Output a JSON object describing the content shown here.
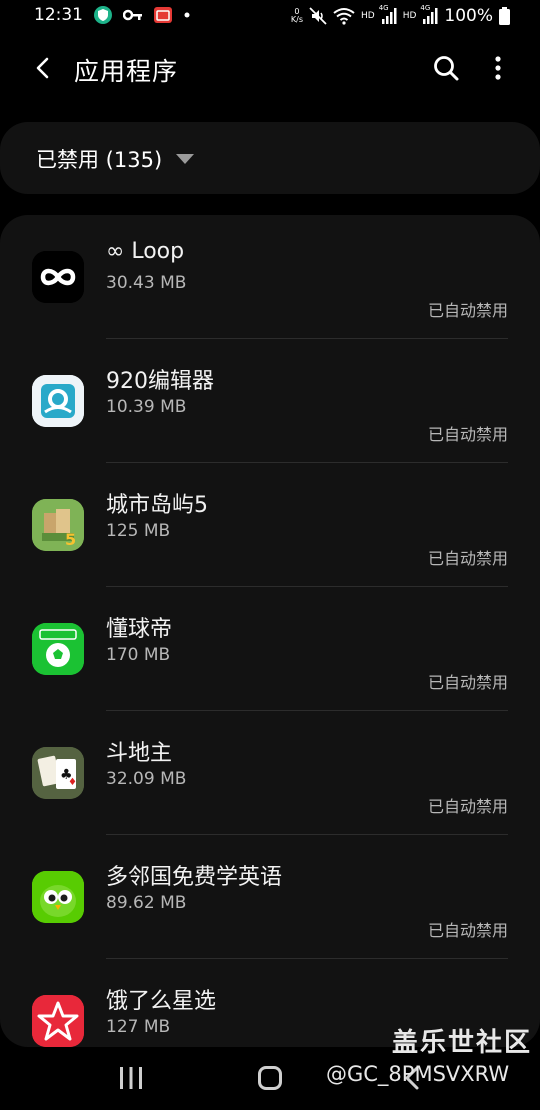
{
  "status_bar": {
    "time": "12:31",
    "speed_top": "0",
    "speed_bottom": "K/s",
    "hd1": "HD",
    "net1": "4G",
    "hd2": "HD",
    "net2": "4G",
    "battery": "100%",
    "icons": [
      "shield-app-icon",
      "key-icon",
      "calendar-app-icon",
      "dot-icon",
      "mute-icon",
      "wifi-icon",
      "signal-icon",
      "battery-icon"
    ]
  },
  "app_bar": {
    "title": "应用程序",
    "icons": [
      "back-arrow-icon",
      "search-icon",
      "more-vertical-icon"
    ]
  },
  "filter": {
    "label": "已禁用 (135)"
  },
  "apps": [
    {
      "name": "∞ Loop",
      "size": "30.43 MB",
      "status": "已自动禁用",
      "icon": "loop-icon"
    },
    {
      "name": "920编辑器",
      "size": "10.39 MB",
      "status": "已自动禁用",
      "icon": "920-editor-icon"
    },
    {
      "name": "城市岛屿5",
      "size": "125 MB",
      "status": "已自动禁用",
      "icon": "city-island-icon"
    },
    {
      "name": "懂球帝",
      "size": "170 MB",
      "status": "已自动禁用",
      "icon": "dongqiudi-icon"
    },
    {
      "name": "斗地主",
      "size": "32.09 MB",
      "status": "已自动禁用",
      "icon": "doudizhu-icon"
    },
    {
      "name": "多邻国免费学英语",
      "size": "89.62 MB",
      "status": "已自动禁用",
      "icon": "duolingo-icon"
    },
    {
      "name": "饿了么星选",
      "size": "127 MB",
      "status": "",
      "icon": "eleme-icon"
    }
  ],
  "watermark": {
    "site": "盖乐世社区",
    "user": "@GC_8PMSVXRW"
  },
  "colors": {
    "background": "#000000",
    "card": "#121212",
    "secondary_text": "#b7b7b7"
  }
}
